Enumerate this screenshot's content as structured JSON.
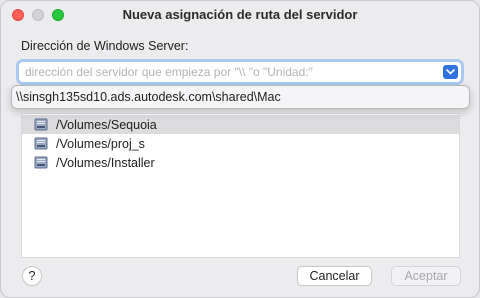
{
  "window": {
    "title": "Nueva asignación de ruta del servidor"
  },
  "form": {
    "label": "Dirección de Windows Server:",
    "input_placeholder": "dirección del servidor que empieza por \"\\\\ \"o \"Unidad:\""
  },
  "dropdown": {
    "items": [
      "\\\\sinsgh135sd10.ads.autodesk.com\\shared\\Mac"
    ]
  },
  "volumes": {
    "items": [
      {
        "label": "/Volumes/Sequoia",
        "selected": true,
        "icon": "drive-icon"
      },
      {
        "label": "/Volumes/proj_s",
        "selected": false,
        "icon": "drive-icon"
      },
      {
        "label": "/Volumes/Installer",
        "selected": false,
        "icon": "drive-icon"
      }
    ]
  },
  "buttons": {
    "help": "?",
    "cancel": "Cancelar",
    "accept": "Aceptar"
  },
  "colors": {
    "accent": "#2f72e0",
    "focus_ring": "#a9c8f2",
    "close": "#ff5f57",
    "maximize": "#28c840"
  }
}
